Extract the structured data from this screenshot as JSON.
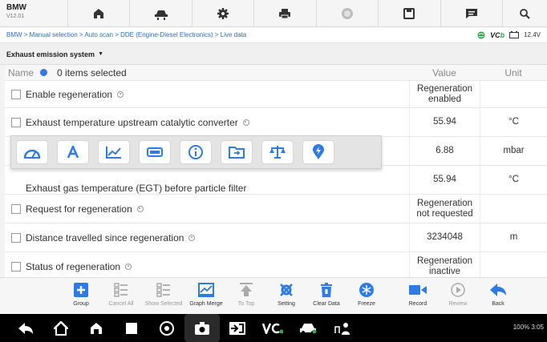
{
  "app": {
    "title": "BMW",
    "version": "V12.01"
  },
  "breadcrumb": "BMW > Manual selection > Auto scan > DDE (Engine-Diesel Electronics) > Live data",
  "status_right": {
    "vci": "VC",
    "battery": "12.4V"
  },
  "section": {
    "title": "Exhaust emission system"
  },
  "table": {
    "header": {
      "name": "Name",
      "selected": "0 items selected",
      "value": "Value",
      "unit": "Unit"
    },
    "rows": [
      {
        "name": "Enable regeneration",
        "value": "Regeneration enabled",
        "unit": ""
      },
      {
        "name": "Exhaust temperature upstream catalytic converter",
        "value": "55.94",
        "unit": "°C"
      },
      {
        "name": "",
        "value": "6.88",
        "unit": "mbar"
      },
      {
        "name": "Exhaust gas temperature (EGT) before particle filter",
        "value": "55.94",
        "unit": "°C"
      },
      {
        "name": "Request for regeneration",
        "value": "Regeneration not requested",
        "unit": ""
      },
      {
        "name": "Distance travelled since regeneration",
        "value": "3234048",
        "unit": "m"
      },
      {
        "name": "Status of regeneration",
        "value": "Regeneration inactive",
        "unit": ""
      }
    ]
  },
  "popup_icons": [
    "gauge-icon",
    "text-icon",
    "line-chart-icon",
    "bar-icon",
    "info-icon",
    "folder-icon",
    "scale-icon",
    "pin-icon"
  ],
  "functions": [
    {
      "label": "Group"
    },
    {
      "label": "Cancel All"
    },
    {
      "label": "Show Selected"
    },
    {
      "label": "Graph Merge"
    },
    {
      "label": "To Top"
    },
    {
      "label": "Setting"
    },
    {
      "label": "Clear Data"
    },
    {
      "label": "Freeze"
    },
    {
      "label": "Record"
    },
    {
      "label": "Review"
    },
    {
      "label": "Back"
    }
  ],
  "system_status": "100%",
  "system_time": "3:05",
  "colors": {
    "accent": "#2f7be6",
    "link": "#2a6fc9",
    "vci_green": "#2fa84f"
  }
}
